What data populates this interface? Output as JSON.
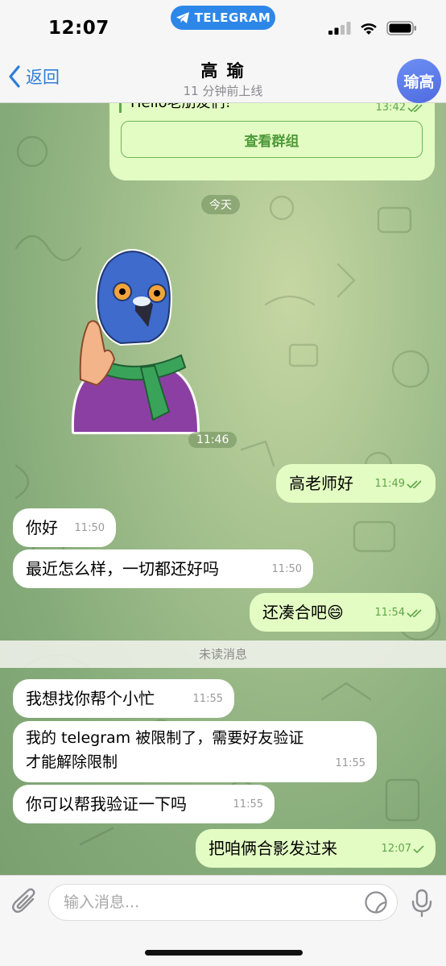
{
  "status": {
    "time": "12:07",
    "pill_label": "TELEGRAM"
  },
  "nav": {
    "back_label": "返回",
    "title": "高 瑜",
    "subtitle": "11 分钟前上线",
    "avatar_text": "瑜高"
  },
  "chat": {
    "group_card": {
      "preview": "Hello老朋友们!",
      "time": "13:42",
      "button_label": "查看群组"
    },
    "date_label": "今天",
    "sticker_time": "11:46",
    "unread_label": "未读消息",
    "messages": [
      {
        "direction": "out",
        "text": "高老师好",
        "time": "11:49",
        "status": "read"
      },
      {
        "direction": "in",
        "text": "你好",
        "time": "11:50"
      },
      {
        "direction": "in",
        "text": "最近怎么样，一切都还好吗",
        "time": "11:50"
      },
      {
        "direction": "out",
        "text": "还凑合吧😄",
        "time": "11:54",
        "status": "read"
      },
      {
        "direction": "in",
        "text": "我想找你帮个小忙",
        "time": "11:55"
      },
      {
        "direction": "in",
        "text": "我的 telegram 被限制了，需要好友验证\n才能解除限制",
        "time": "11:55"
      },
      {
        "direction": "in",
        "text": "你可以帮我验证一下吗",
        "time": "11:55"
      },
      {
        "direction": "out",
        "text": "把咱俩合影发过来",
        "time": "12:07",
        "status": "sent"
      }
    ]
  },
  "input": {
    "placeholder": "输入消息..."
  },
  "colors": {
    "accent": "#2f7ed8",
    "outgoing_bubble": "#e3fcc3",
    "incoming_bubble": "#ffffff",
    "check": "#5fa64a"
  }
}
